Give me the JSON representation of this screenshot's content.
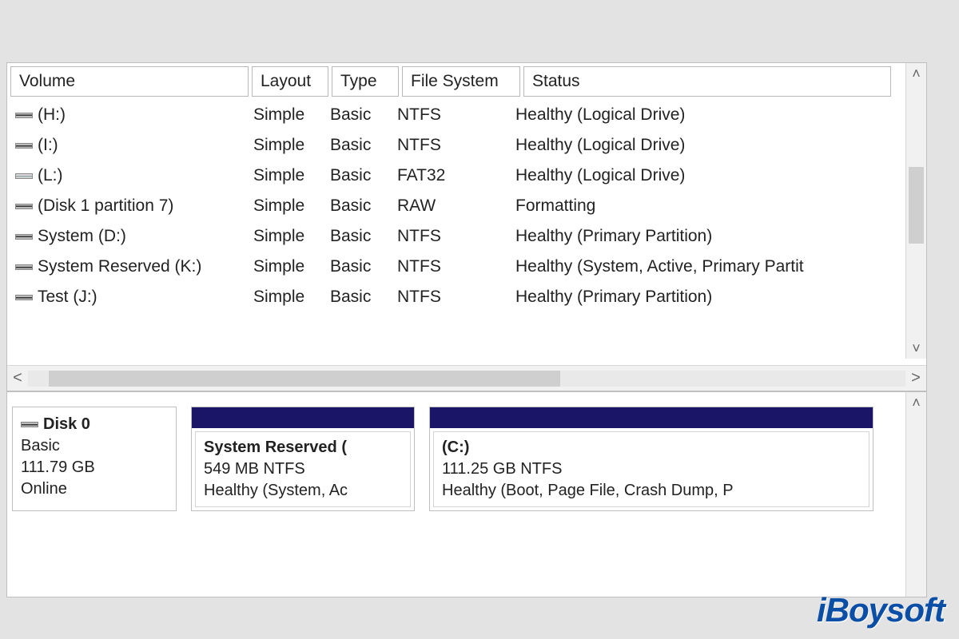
{
  "columns": {
    "volume": "Volume",
    "layout": "Layout",
    "type": "Type",
    "fs": "File System",
    "status": "Status"
  },
  "volumes": [
    {
      "icon": "dark",
      "name": " (H:)",
      "layout": "Simple",
      "type": "Basic",
      "fs": "NTFS",
      "status": "Healthy (Logical Drive)"
    },
    {
      "icon": "dark",
      "name": " (I:)",
      "layout": "Simple",
      "type": "Basic",
      "fs": "NTFS",
      "status": "Healthy (Logical Drive)"
    },
    {
      "icon": "light",
      "name": " (L:)",
      "layout": "Simple",
      "type": "Basic",
      "fs": "FAT32",
      "status": "Healthy (Logical Drive)"
    },
    {
      "icon": "dark",
      "name": "(Disk 1 partition 7)",
      "layout": "Simple",
      "type": "Basic",
      "fs": "RAW",
      "status": "Formatting"
    },
    {
      "icon": "dark",
      "name": "System (D:)",
      "layout": "Simple",
      "type": "Basic",
      "fs": "NTFS",
      "status": "Healthy (Primary Partition)"
    },
    {
      "icon": "dark",
      "name": "System Reserved (K:)",
      "layout": "Simple",
      "type": "Basic",
      "fs": "NTFS",
      "status": "Healthy (System, Active, Primary Partit"
    },
    {
      "icon": "dark",
      "name": "Test (J:)",
      "layout": "Simple",
      "type": "Basic",
      "fs": "NTFS",
      "status": "Healthy (Primary Partition)"
    }
  ],
  "disk": {
    "title": "Disk 0",
    "type": "Basic",
    "size": "111.79 GB",
    "state": "Online"
  },
  "partitions": [
    {
      "name": "System Reserved  (",
      "line2": "549 MB NTFS",
      "line3": "Healthy (System, Ac"
    },
    {
      "name": "(C:)",
      "line2": "111.25 GB NTFS",
      "line3": "Healthy (Boot, Page File, Crash Dump, P"
    }
  ],
  "watermark": {
    "brand1": "iB",
    "brand2": "oysoft"
  }
}
